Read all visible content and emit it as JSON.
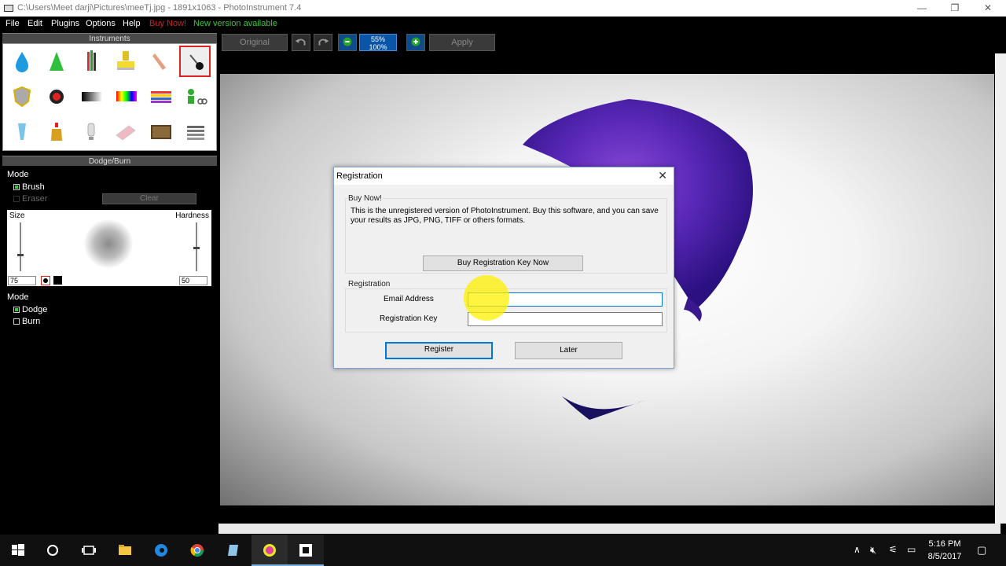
{
  "window": {
    "title": "C:\\Users\\Meet darji\\Pictures\\meeTj.jpg - 1891x1063 - PhotoInstrument 7.4",
    "minimize": "—",
    "maximize": "❐",
    "close": "✕"
  },
  "menu": {
    "items": [
      "File",
      "Edit",
      "Plugins",
      "Options",
      "Help"
    ],
    "buy_now": "Buy Now!",
    "new_version": "New version available"
  },
  "instruments_panel": {
    "title": "Instruments"
  },
  "dodge_panel": {
    "title": "Dodge/Burn",
    "mode_label": "Mode",
    "brush": "Brush",
    "eraser": "Eraser",
    "clear": "Clear",
    "size_label": "Size",
    "hardness_label": "Hardness",
    "size_value": "75",
    "hardness_value": "50",
    "mode2_label": "Mode",
    "dodge": "Dodge",
    "burn": "Burn"
  },
  "toolbar": {
    "original": "Original",
    "zoom_top": "55%",
    "zoom_bottom": "100%",
    "apply": "Apply"
  },
  "dialog": {
    "title": "Registration",
    "close": "✕",
    "buy_group": "Buy Now!",
    "buy_text": "This is the unregistered version of PhotoInstrument. Buy this software, and you can save your results as JPG, PNG, TIFF or others formats.",
    "buy_button": "Buy Registration Key Now",
    "reg_group": "Registration",
    "email_label": "Email Address",
    "email_value": "",
    "key_label": "Registration Key",
    "key_value": "",
    "register_button": "Register",
    "later_button": "Later"
  },
  "taskbar": {
    "time": "5:16 PM",
    "date": "8/5/2017"
  },
  "colors": {
    "accent": "#0078d7",
    "new_version": "#33cc33",
    "buy_now": "#cc2222"
  }
}
